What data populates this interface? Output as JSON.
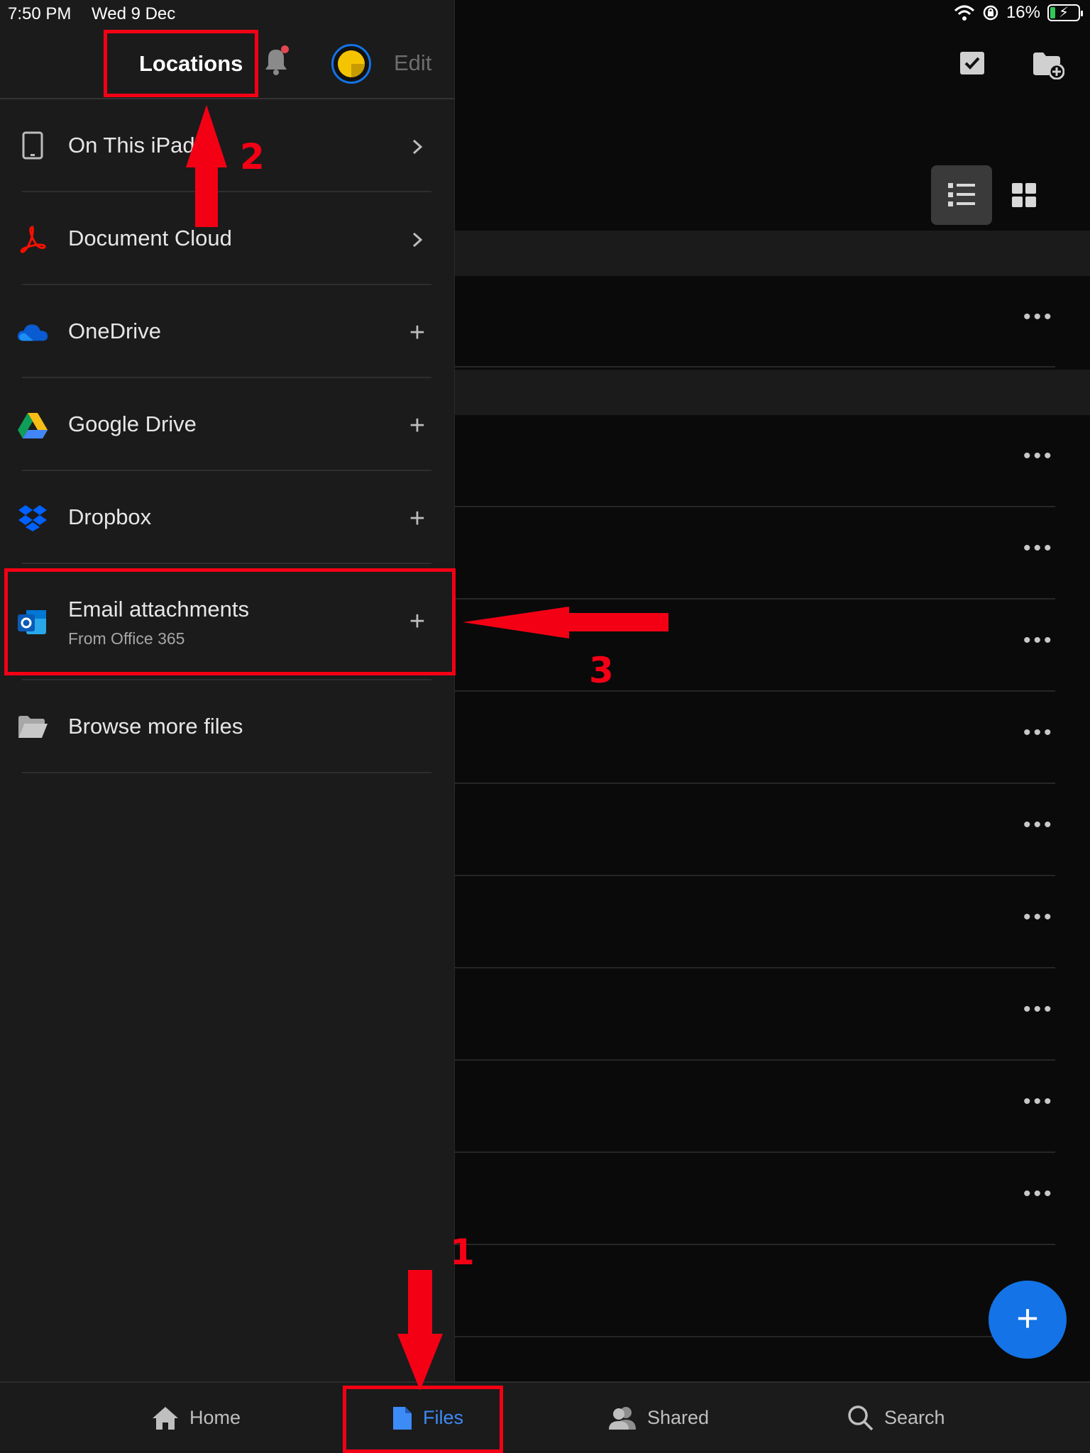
{
  "status_bar": {
    "time": "7:50 PM",
    "date": "Wed 9 Dec",
    "battery": "16%"
  },
  "sidebar": {
    "title": "Locations",
    "edit_label": "Edit",
    "items": [
      {
        "label": "On This iPad",
        "icon": "ipad-icon",
        "action": "chevron"
      },
      {
        "label": "Document Cloud",
        "icon": "acrobat-icon",
        "action": "chevron"
      },
      {
        "label": "OneDrive",
        "icon": "onedrive-icon",
        "action": "plus"
      },
      {
        "label": "Google Drive",
        "icon": "google-drive-icon",
        "action": "plus"
      },
      {
        "label": "Dropbox",
        "icon": "dropbox-icon",
        "action": "plus"
      },
      {
        "label": "Email attachments",
        "sublabel": "From Office 365",
        "icon": "outlook-icon",
        "action": "plus"
      },
      {
        "label": "Browse more files",
        "icon": "folder-icon",
        "action": "none"
      }
    ]
  },
  "nav": {
    "items": [
      {
        "label": "Home",
        "icon": "home-icon"
      },
      {
        "label": "Files",
        "icon": "file-icon",
        "active": true
      },
      {
        "label": "Shared",
        "icon": "people-icon"
      },
      {
        "label": "Search",
        "icon": "search-icon"
      }
    ]
  },
  "annotations": {
    "step1": "1",
    "step2": "2",
    "step3": "3"
  },
  "colors": {
    "accent": "#1473e6",
    "annotation": "#f30015",
    "sidebar_bg": "#1b1b1b",
    "main_bg": "#0a0a0a"
  }
}
